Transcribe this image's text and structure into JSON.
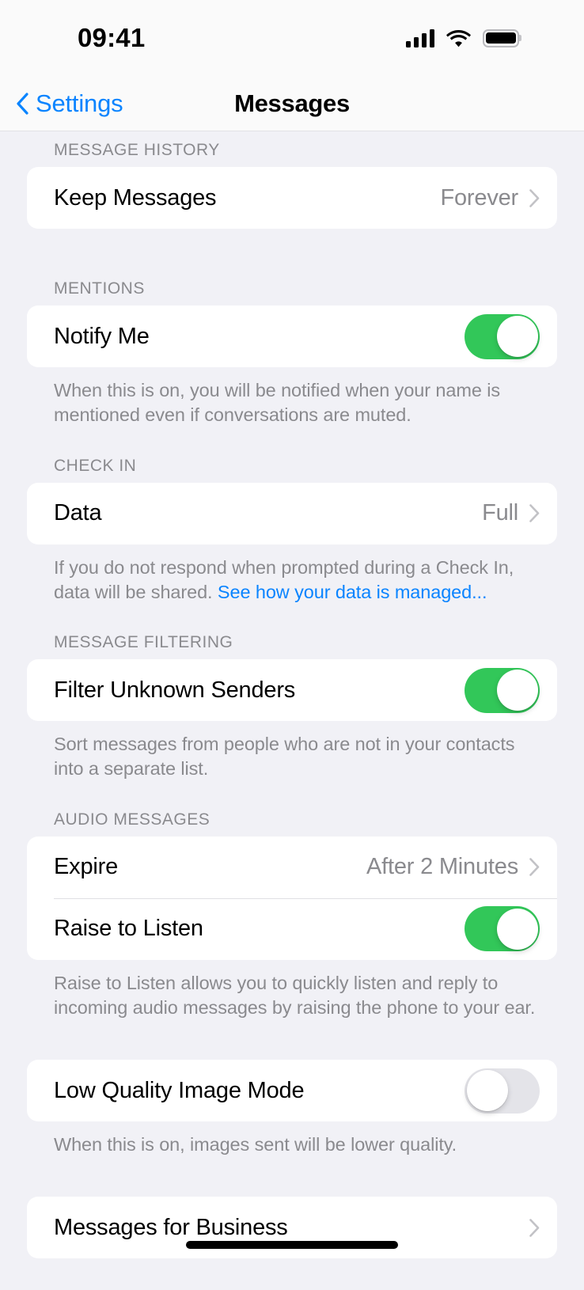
{
  "status_bar": {
    "time": "09:41",
    "signal_icon": "cellular-signal-icon",
    "wifi_icon": "wifi-icon",
    "battery_icon": "battery-full-icon"
  },
  "nav": {
    "back_label": "Settings",
    "back_icon": "chevron-left-icon",
    "title": "Messages"
  },
  "colors": {
    "accent_blue": "#0a84ff",
    "toggle_on_green": "#32c759",
    "toggle_off_gray": "#e4e4e9",
    "page_background": "#f1f1f6",
    "card_background": "#ffffff",
    "secondary_text": "#8a8a8e"
  },
  "sections": [
    {
      "header": "MESSAGE HISTORY",
      "rows": [
        {
          "label": "Keep Messages",
          "value": "Forever",
          "type": "disclosure"
        }
      ],
      "footnote": null
    },
    {
      "header": "MENTIONS",
      "rows": [
        {
          "label": "Notify Me",
          "type": "toggle",
          "state": "on"
        }
      ],
      "footnote": "When this is on, you will be notified when your name is mentioned even if conversations are muted."
    },
    {
      "header": "CHECK IN",
      "rows": [
        {
          "label": "Data",
          "value": "Full",
          "type": "disclosure"
        }
      ],
      "footnote_prefix": "If you do not respond when prompted during a Check In, data will be shared. ",
      "footnote_link": "See how your data is managed..."
    },
    {
      "header": "MESSAGE FILTERING",
      "rows": [
        {
          "label": "Filter Unknown Senders",
          "type": "toggle",
          "state": "on"
        }
      ],
      "footnote": "Sort messages from people who are not in your contacts into a separate list."
    },
    {
      "header": "AUDIO MESSAGES",
      "rows": [
        {
          "label": "Expire",
          "value": "After 2 Minutes",
          "type": "disclosure"
        },
        {
          "label": "Raise to Listen",
          "type": "toggle",
          "state": "on"
        }
      ],
      "footnote": "Raise to Listen allows you to quickly listen and reply to incoming audio messages by raising the phone to your ear."
    },
    {
      "header": null,
      "rows": [
        {
          "label": "Low Quality Image Mode",
          "type": "toggle",
          "state": "off"
        }
      ],
      "footnote": "When this is on, images sent will be lower quality."
    },
    {
      "header": null,
      "rows": [
        {
          "label": "Messages for Business",
          "value": "",
          "type": "disclosure"
        }
      ],
      "footnote": null
    }
  ]
}
